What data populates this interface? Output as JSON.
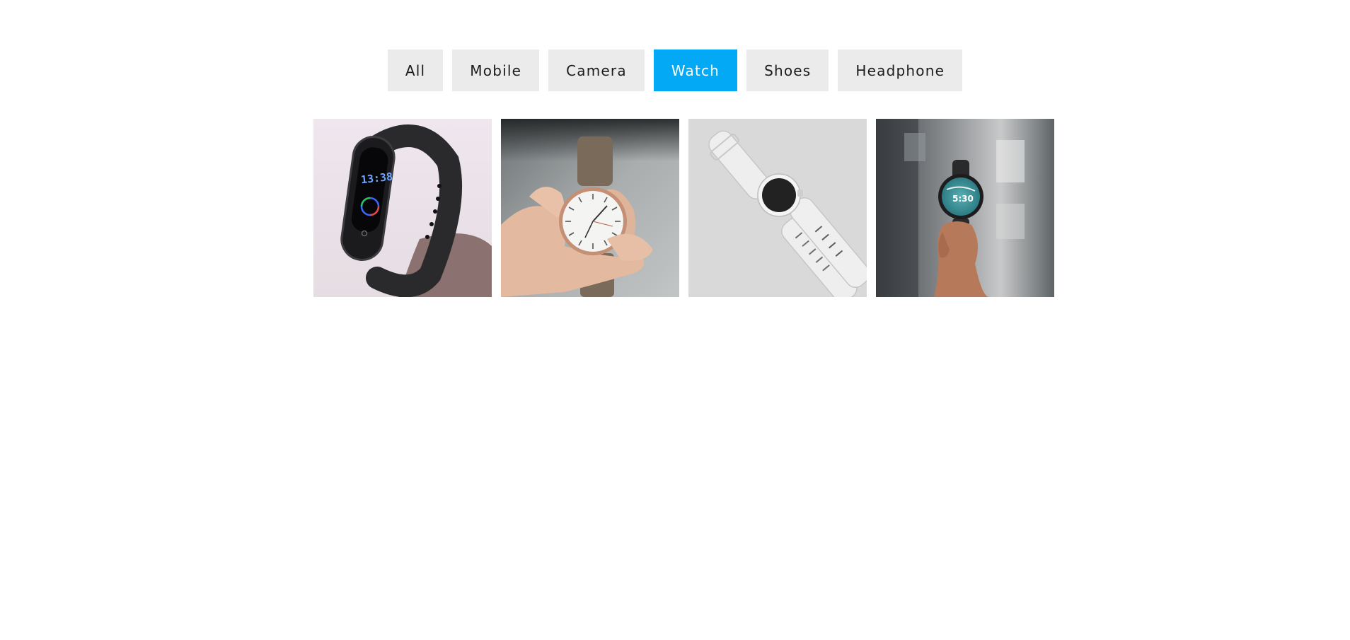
{
  "filters": {
    "items": [
      {
        "label": "All"
      },
      {
        "label": "Mobile"
      },
      {
        "label": "Camera"
      },
      {
        "label": "Watch"
      },
      {
        "label": "Shoes"
      },
      {
        "label": "Headphone"
      }
    ],
    "active": "Watch",
    "active_color": "#03a9f4",
    "inactive_color": "#ebebeb"
  },
  "gallery": {
    "items": [
      {
        "name": "fitness-band-watch-image",
        "screen_time": "13:38"
      },
      {
        "name": "analog-wristwatch-image"
      },
      {
        "name": "white-smartwatch-image"
      },
      {
        "name": "round-smartwatch-image",
        "screen_time": "5:30"
      }
    ]
  }
}
